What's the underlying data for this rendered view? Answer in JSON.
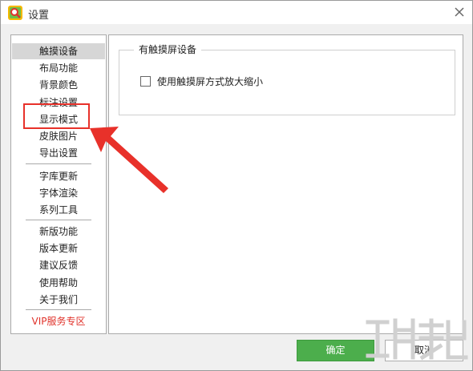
{
  "window": {
    "title": "设置",
    "icon": "app-logo-icon",
    "close_icon": "close-icon"
  },
  "sidebar": {
    "groups": [
      [
        "触摸设备",
        "布局功能",
        "背景颜色",
        "标注设置",
        "显示模式",
        "皮肤图片",
        "导出设置"
      ],
      [
        "字库更新",
        "字体渲染",
        "系列工具"
      ],
      [
        "新版功能",
        "版本更新",
        "建议反馈",
        "使用帮助",
        "关于我们"
      ]
    ],
    "items": {
      "touch": "触摸设备",
      "layout": "布局功能",
      "background": "背景颜色",
      "annotation": "标注设置",
      "display": "显示模式",
      "skin": "皮肤图片",
      "export": "导出设置",
      "fontlib": "字库更新",
      "render": "字体渲染",
      "tools": "系列工具",
      "newfeat": "新版功能",
      "update": "版本更新",
      "feedback": "建议反馈",
      "help": "使用帮助",
      "about": "关于我们",
      "vip": "VIP服务专区"
    },
    "active": "触摸设备",
    "vip_color": "#e0322a"
  },
  "content": {
    "group_title": "有触摸屏设备",
    "checkbox_label": "使用触摸屏方式放大缩小",
    "checkbox_checked": false
  },
  "footer": {
    "ok_label": "确定",
    "cancel_label": "取消",
    "ok_color": "#4cae4c"
  },
  "annotation": {
    "highlight_color": "#e8312a"
  }
}
